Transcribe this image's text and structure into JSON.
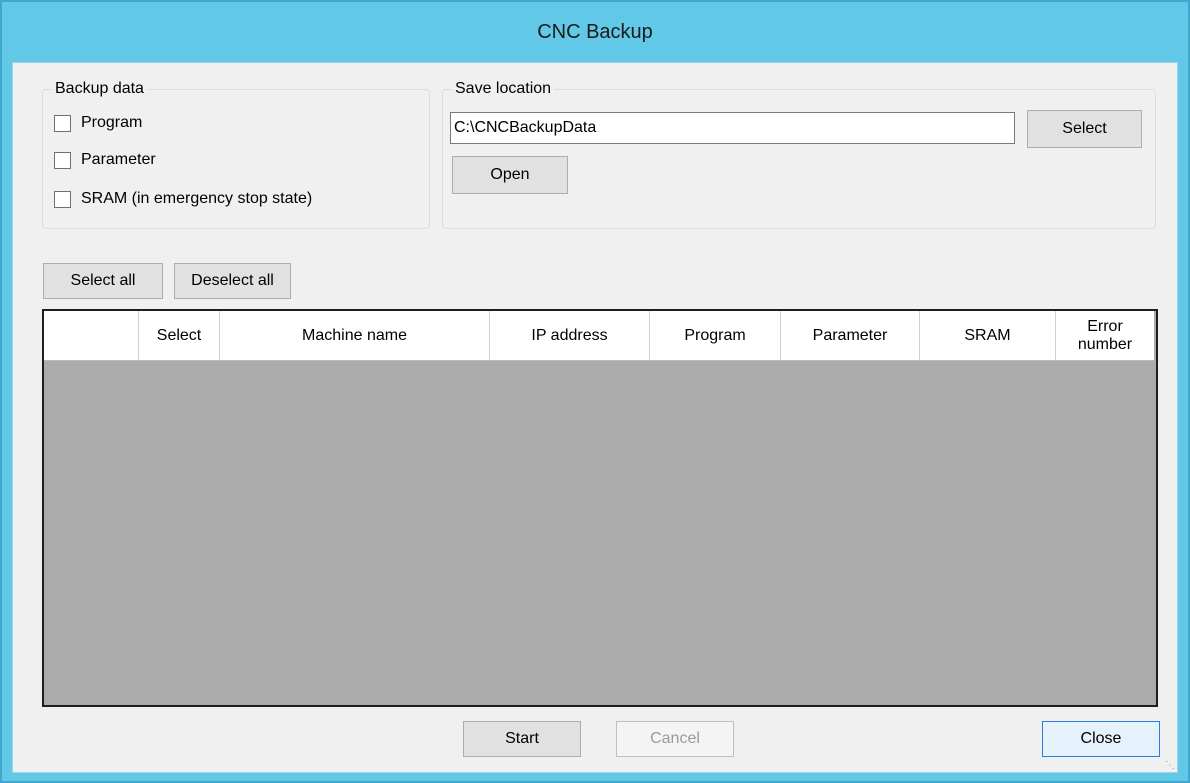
{
  "window": {
    "title": "CNC Backup"
  },
  "backup_data": {
    "legend": "Backup data",
    "options": [
      {
        "label": "Program",
        "checked": false
      },
      {
        "label": "Parameter",
        "checked": false
      },
      {
        "label": "SRAM (in emergency stop state)",
        "checked": false
      }
    ]
  },
  "save_location": {
    "legend": "Save location",
    "path_value": "C:\\CNCBackupData",
    "select_label": "Select",
    "open_label": "Open"
  },
  "selection": {
    "select_all_label": "Select all",
    "deselect_all_label": "Deselect all"
  },
  "grid": {
    "columns": [
      "",
      "Select",
      "Machine name",
      "IP address",
      "Program",
      "Parameter",
      "SRAM",
      "Error number"
    ],
    "rows": []
  },
  "footer": {
    "start_label": "Start",
    "cancel_label": "Cancel",
    "close_label": "Close"
  },
  "colors": {
    "titlebar": "#62c8e8",
    "client": "#f0f0f0",
    "grid_background": "#ababab"
  }
}
